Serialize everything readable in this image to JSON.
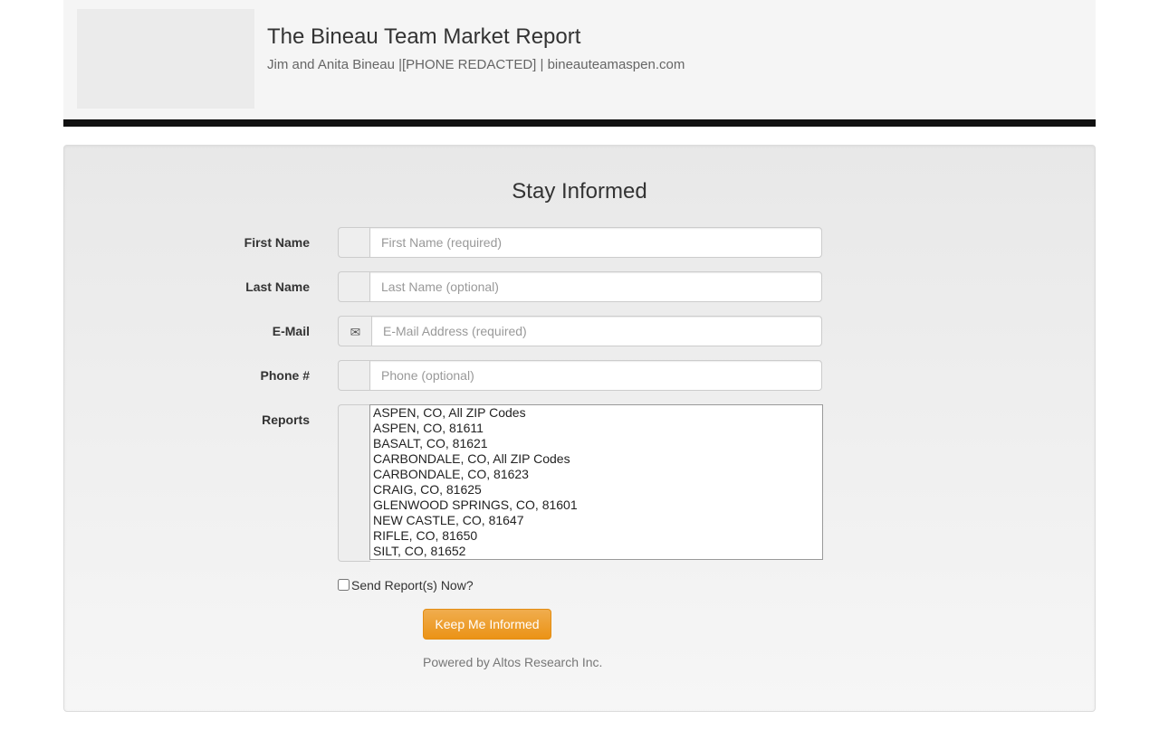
{
  "header": {
    "title": "The Bineau Team Market Report",
    "subtitle": "Jim and Anita Bineau |[PHONE REDACTED] | bineauteamaspen.com"
  },
  "form": {
    "heading": "Stay Informed",
    "first_name": {
      "label": "First Name",
      "placeholder": "First Name (required)",
      "value": ""
    },
    "last_name": {
      "label": "Last Name",
      "placeholder": "Last Name (optional)",
      "value": ""
    },
    "email": {
      "label": "E-Mail",
      "placeholder": "E-Mail Address (required)",
      "value": "",
      "icon": "envelope-icon",
      "icon_glyph": "✉"
    },
    "phone": {
      "label": "Phone #",
      "placeholder": "Phone (optional)",
      "value": ""
    },
    "reports": {
      "label": "Reports",
      "options": [
        "ASPEN, CO, All ZIP Codes",
        "ASPEN, CO, 81611",
        "BASALT, CO, 81621",
        "CARBONDALE, CO, All ZIP Codes",
        "CARBONDALE, CO, 81623",
        "CRAIG, CO, 81625",
        "GLENWOOD SPRINGS, CO, 81601",
        "NEW CASTLE, CO, 81647",
        "RIFLE, CO, 81650",
        "SILT, CO, 81652"
      ]
    },
    "send_now": {
      "label": "Send Report(s) Now?",
      "checked": false
    },
    "submit_label": "Keep Me Informed",
    "powered_by": "Powered by Altos Research Inc."
  },
  "colors": {
    "button": "#f0ad4e",
    "header_rule": "#111111",
    "panel_bg": "#eeeeee"
  }
}
